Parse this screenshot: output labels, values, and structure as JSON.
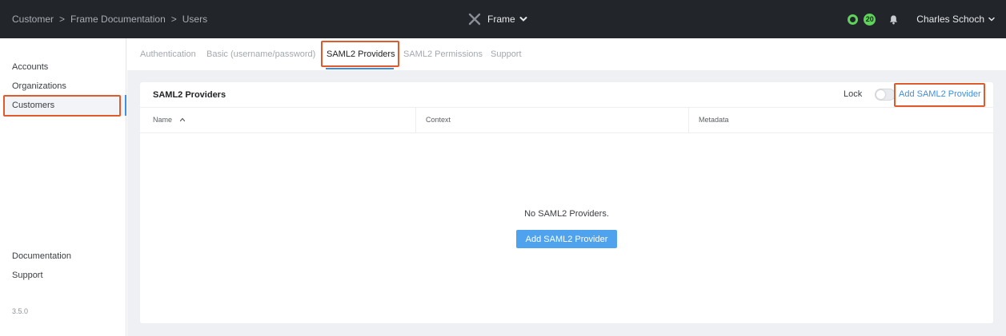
{
  "breadcrumb": [
    "Customer",
    "Frame Documentation",
    "Users"
  ],
  "breadcrumb_sep": ">",
  "brand": {
    "name": "Frame"
  },
  "top_right": {
    "badge_count": "20",
    "user_name": "Charles Schoch"
  },
  "sidebar": {
    "items": [
      {
        "label": "Accounts"
      },
      {
        "label": "Organizations"
      },
      {
        "label": "Customers",
        "active": true
      }
    ],
    "footer_items": [
      {
        "label": "Documentation"
      },
      {
        "label": "Support"
      }
    ],
    "version": "3.5.0"
  },
  "tabs": [
    {
      "label": "Authentication"
    },
    {
      "label": "Basic (username/password)"
    },
    {
      "label": "SAML2 Providers",
      "active": true
    },
    {
      "label": "SAML2 Permissions"
    },
    {
      "label": "Support"
    }
  ],
  "card": {
    "title": "SAML2 Providers",
    "lock_label": "Lock",
    "lock_on": false,
    "add_link": "Add SAML2 Provider",
    "columns": [
      "Name",
      "Context",
      "Metadata"
    ],
    "empty_text": "No SAML2 Providers.",
    "empty_button": "Add SAML2 Provider"
  },
  "colors": {
    "topbar": "#22252a",
    "accent": "#3d8fe0",
    "status_green": "#5fd35a",
    "highlight": "#e05a2b"
  }
}
